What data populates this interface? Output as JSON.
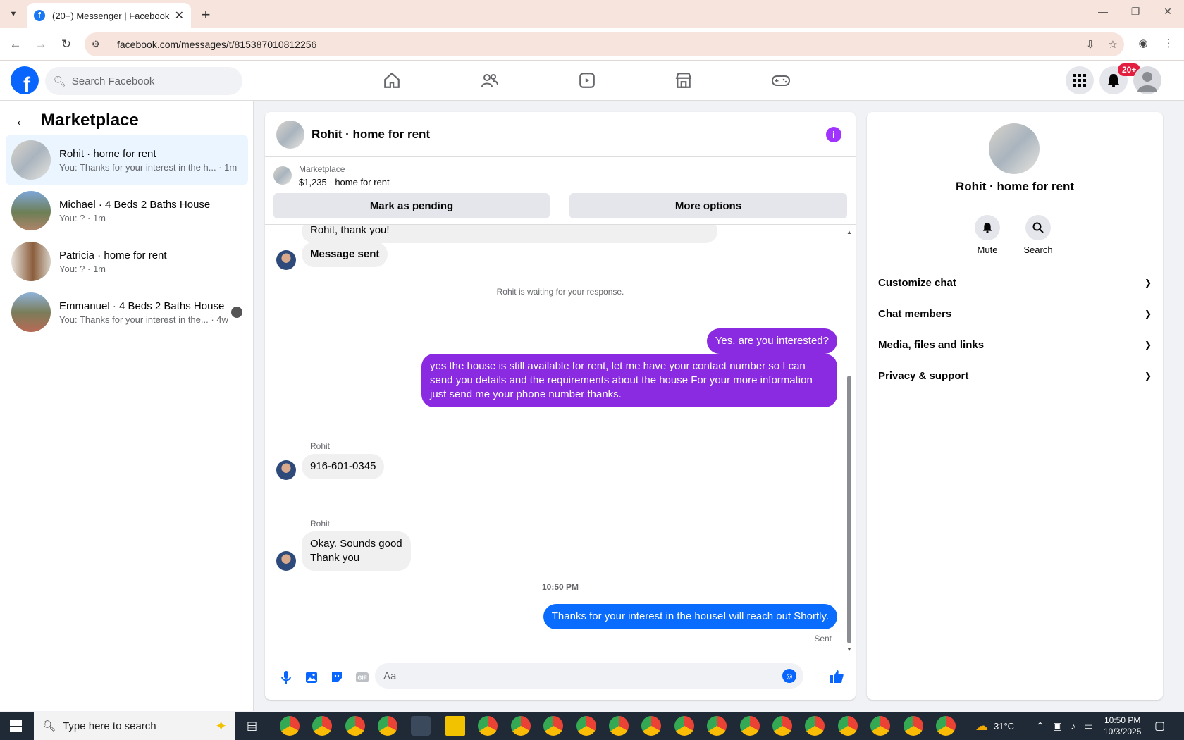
{
  "browser": {
    "tab_title": "(20+) Messenger | Facebook",
    "url": "facebook.com/messages/t/815387010812256"
  },
  "header": {
    "search_placeholder": "Search Facebook",
    "notification_count": "20+"
  },
  "sidebar": {
    "title": "Marketplace",
    "conversations": [
      {
        "name": "Rohit · home for rent",
        "preview": "You: Thanks for your interest in the h... · 1m",
        "active": true
      },
      {
        "name": "Michael · 4 Beds 2 Baths House",
        "preview": "You: ? · 1m",
        "active": false
      },
      {
        "name": "Patricia · home for rent",
        "preview": "You: ? · 1m",
        "active": false
      },
      {
        "name": "Emmanuel · 4 Beds 2 Baths House",
        "preview": "You: Thanks for your interest in the... · 4w",
        "active": false
      }
    ]
  },
  "chat": {
    "title": "Rohit · home for rent",
    "marketplace_label": "Marketplace",
    "listing": "$1,235 - home for rent",
    "mark_pending": "Mark as pending",
    "more_options": "More options",
    "messages": {
      "partial_top": "Rohit, thank you!",
      "msg_sent": "Message sent",
      "waiting_note": "Rohit is waiting for your response.",
      "out1": "Yes, are you interested?",
      "out2": "yes the house is still available for rent, let me have your contact number so I can send you details and the requirements about the house For  your  more  information  just send  me   your  phone  number thanks.",
      "sender1": "Rohit",
      "in_phone": "916-601-0345",
      "sender2": "Rohit",
      "in_okay_1": "Okay. Sounds good",
      "in_okay_2": "Thank you",
      "time": "10:50 PM",
      "out3": "Thanks for your interest in the houseI will reach out Shortly.",
      "status": "Sent"
    },
    "composer_placeholder": "Aa"
  },
  "right_panel": {
    "name": "Rohit · home for rent",
    "mute": "Mute",
    "search": "Search",
    "sections": [
      "Customize chat",
      "Chat members",
      "Media, files and links",
      "Privacy & support"
    ]
  },
  "taskbar": {
    "search_placeholder": "Type here to search",
    "temperature": "31°C",
    "time": "10:50 PM",
    "date": "10/3/2025"
  },
  "colors": {
    "fb_blue": "#0866ff",
    "purple_bubble": "#8a2be2",
    "blue_bubble": "#0a6cff"
  }
}
